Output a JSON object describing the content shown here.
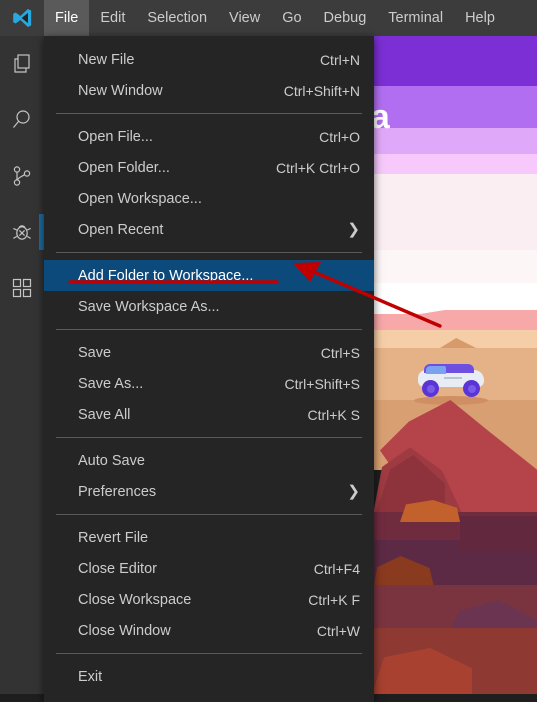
{
  "app": {
    "name": "Visual Studio Code",
    "logo_icon": "vscode-logo-icon"
  },
  "menubar": {
    "items": [
      {
        "label": "File",
        "active": true
      },
      {
        "label": "Edit",
        "active": false
      },
      {
        "label": "Selection",
        "active": false
      },
      {
        "label": "View",
        "active": false
      },
      {
        "label": "Go",
        "active": false
      },
      {
        "label": "Debug",
        "active": false
      },
      {
        "label": "Terminal",
        "active": false
      },
      {
        "label": "Help",
        "active": false
      }
    ]
  },
  "activity_bar": {
    "items": [
      {
        "name": "explorer",
        "icon": "files-icon",
        "active": false
      },
      {
        "name": "search",
        "icon": "search-icon",
        "active": false
      },
      {
        "name": "source-control",
        "icon": "source-control-icon",
        "active": false
      },
      {
        "name": "debug",
        "icon": "debug-bug-icon",
        "active": true
      },
      {
        "name": "extensions",
        "icon": "extensions-icon",
        "active": false
      }
    ]
  },
  "file_menu": {
    "groups": [
      {
        "items": [
          {
            "label": "New File",
            "accel": "Ctrl+N",
            "highlight": false,
            "submenu": false
          },
          {
            "label": "New Window",
            "accel": "Ctrl+Shift+N",
            "highlight": false,
            "submenu": false
          }
        ]
      },
      {
        "items": [
          {
            "label": "Open File...",
            "accel": "Ctrl+O",
            "highlight": false,
            "submenu": false
          },
          {
            "label": "Open Folder...",
            "accel": "Ctrl+K Ctrl+O",
            "highlight": false,
            "submenu": false
          },
          {
            "label": "Open Workspace...",
            "accel": "",
            "highlight": false,
            "submenu": false
          },
          {
            "label": "Open Recent",
            "accel": "",
            "highlight": false,
            "submenu": true
          }
        ]
      },
      {
        "items": [
          {
            "label": "Add Folder to Workspace...",
            "accel": "",
            "highlight": true,
            "submenu": false
          },
          {
            "label": "Save Workspace As...",
            "accel": "",
            "highlight": false,
            "submenu": false
          }
        ]
      },
      {
        "items": [
          {
            "label": "Save",
            "accel": "Ctrl+S",
            "highlight": false,
            "submenu": false
          },
          {
            "label": "Save As...",
            "accel": "Ctrl+Shift+S",
            "highlight": false,
            "submenu": false
          },
          {
            "label": "Save All",
            "accel": "Ctrl+K S",
            "highlight": false,
            "submenu": false
          }
        ]
      },
      {
        "items": [
          {
            "label": "Auto Save",
            "accel": "",
            "highlight": false,
            "submenu": false
          },
          {
            "label": "Preferences",
            "accel": "",
            "highlight": false,
            "submenu": true
          }
        ]
      },
      {
        "items": [
          {
            "label": "Revert File",
            "accel": "",
            "highlight": false,
            "submenu": false
          },
          {
            "label": "Close Editor",
            "accel": "Ctrl+F4",
            "highlight": false,
            "submenu": false
          },
          {
            "label": "Close Workspace",
            "accel": "Ctrl+K F",
            "highlight": false,
            "submenu": false
          },
          {
            "label": "Close Window",
            "accel": "Ctrl+W",
            "highlight": false,
            "submenu": false
          }
        ]
      },
      {
        "items": [
          {
            "label": "Exit",
            "accel": "",
            "highlight": false,
            "submenu": false
          }
        ]
      }
    ]
  },
  "wallpaper": {
    "text": "ka",
    "description": "desert-landscape-with-rover"
  },
  "annotations": {
    "color": "#c00000",
    "underline_target": "Add Folder to Workspace...",
    "arrow_points_to": "Add Folder to Workspace..."
  },
  "colors": {
    "title_bar": "#3c3c3c",
    "activity_bar": "#333333",
    "menu_background": "#252526",
    "menu_highlight": "#0c4a7c",
    "menu_text": "#cccccc",
    "annotation_red": "#c00000",
    "accent_blue": "#1c6ca1"
  }
}
